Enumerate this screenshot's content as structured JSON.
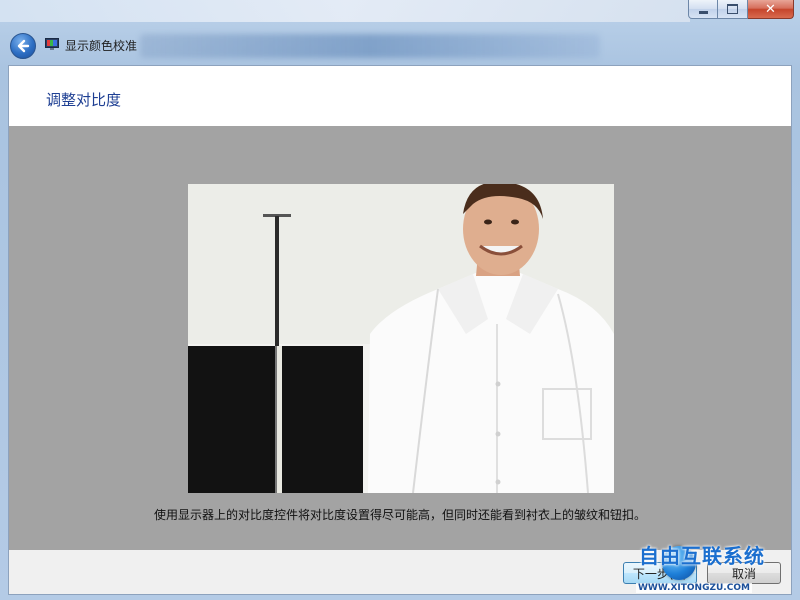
{
  "window": {
    "title": "显示颜色校准",
    "caption_buttons": {
      "minimize": "minimize",
      "maximize": "maximize",
      "close": "✕"
    }
  },
  "page": {
    "heading": "调整对比度",
    "instruction": "使用显示器上的对比度控件将对比度设置得尽可能高，但同时还能看到衬衣上的皱纹和钮扣。"
  },
  "footer": {
    "next_label": "下一步(N)",
    "cancel_label": "取消"
  },
  "watermark": {
    "brand": "自由互联系统",
    "url": "WWW.XITONGZU.COM"
  },
  "icons": {
    "back": "back-arrow-icon",
    "app": "monitor-color-icon",
    "close": "close-icon",
    "minimize": "minimize-icon",
    "maximize": "maximize-icon"
  },
  "colors": {
    "heading": "#1e3f93",
    "panel": "#a3a3a3",
    "accent": "#2d6fc4"
  }
}
